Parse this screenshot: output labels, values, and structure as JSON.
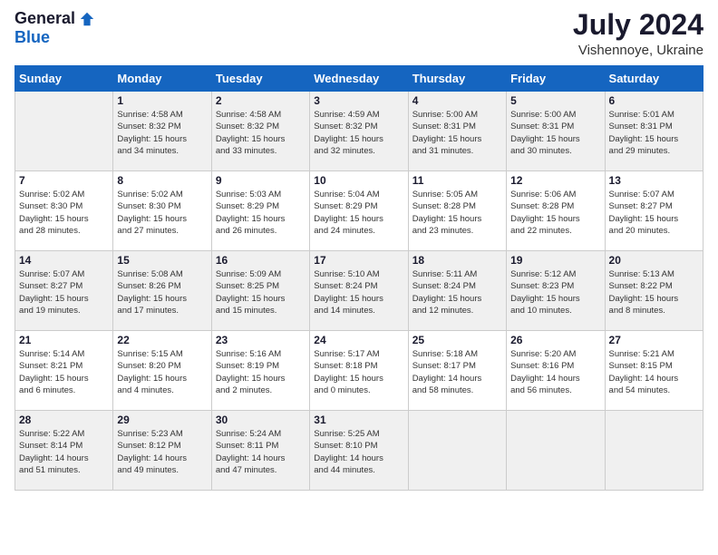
{
  "header": {
    "logo_general": "General",
    "logo_blue": "Blue",
    "month_year": "July 2024",
    "location": "Vishennoye, Ukraine"
  },
  "weekdays": [
    "Sunday",
    "Monday",
    "Tuesday",
    "Wednesday",
    "Thursday",
    "Friday",
    "Saturday"
  ],
  "weeks": [
    [
      {
        "day": "",
        "sunrise": "",
        "sunset": "",
        "daylight": ""
      },
      {
        "day": "1",
        "sunrise": "Sunrise: 4:58 AM",
        "sunset": "Sunset: 8:32 PM",
        "daylight": "Daylight: 15 hours and 34 minutes."
      },
      {
        "day": "2",
        "sunrise": "Sunrise: 4:58 AM",
        "sunset": "Sunset: 8:32 PM",
        "daylight": "Daylight: 15 hours and 33 minutes."
      },
      {
        "day": "3",
        "sunrise": "Sunrise: 4:59 AM",
        "sunset": "Sunset: 8:32 PM",
        "daylight": "Daylight: 15 hours and 32 minutes."
      },
      {
        "day": "4",
        "sunrise": "Sunrise: 5:00 AM",
        "sunset": "Sunset: 8:31 PM",
        "daylight": "Daylight: 15 hours and 31 minutes."
      },
      {
        "day": "5",
        "sunrise": "Sunrise: 5:00 AM",
        "sunset": "Sunset: 8:31 PM",
        "daylight": "Daylight: 15 hours and 30 minutes."
      },
      {
        "day": "6",
        "sunrise": "Sunrise: 5:01 AM",
        "sunset": "Sunset: 8:31 PM",
        "daylight": "Daylight: 15 hours and 29 minutes."
      }
    ],
    [
      {
        "day": "7",
        "sunrise": "Sunrise: 5:02 AM",
        "sunset": "Sunset: 8:30 PM",
        "daylight": "Daylight: 15 hours and 28 minutes."
      },
      {
        "day": "8",
        "sunrise": "Sunrise: 5:02 AM",
        "sunset": "Sunset: 8:30 PM",
        "daylight": "Daylight: 15 hours and 27 minutes."
      },
      {
        "day": "9",
        "sunrise": "Sunrise: 5:03 AM",
        "sunset": "Sunset: 8:29 PM",
        "daylight": "Daylight: 15 hours and 26 minutes."
      },
      {
        "day": "10",
        "sunrise": "Sunrise: 5:04 AM",
        "sunset": "Sunset: 8:29 PM",
        "daylight": "Daylight: 15 hours and 24 minutes."
      },
      {
        "day": "11",
        "sunrise": "Sunrise: 5:05 AM",
        "sunset": "Sunset: 8:28 PM",
        "daylight": "Daylight: 15 hours and 23 minutes."
      },
      {
        "day": "12",
        "sunrise": "Sunrise: 5:06 AM",
        "sunset": "Sunset: 8:28 PM",
        "daylight": "Daylight: 15 hours and 22 minutes."
      },
      {
        "day": "13",
        "sunrise": "Sunrise: 5:07 AM",
        "sunset": "Sunset: 8:27 PM",
        "daylight": "Daylight: 15 hours and 20 minutes."
      }
    ],
    [
      {
        "day": "14",
        "sunrise": "Sunrise: 5:07 AM",
        "sunset": "Sunset: 8:27 PM",
        "daylight": "Daylight: 15 hours and 19 minutes."
      },
      {
        "day": "15",
        "sunrise": "Sunrise: 5:08 AM",
        "sunset": "Sunset: 8:26 PM",
        "daylight": "Daylight: 15 hours and 17 minutes."
      },
      {
        "day": "16",
        "sunrise": "Sunrise: 5:09 AM",
        "sunset": "Sunset: 8:25 PM",
        "daylight": "Daylight: 15 hours and 15 minutes."
      },
      {
        "day": "17",
        "sunrise": "Sunrise: 5:10 AM",
        "sunset": "Sunset: 8:24 PM",
        "daylight": "Daylight: 15 hours and 14 minutes."
      },
      {
        "day": "18",
        "sunrise": "Sunrise: 5:11 AM",
        "sunset": "Sunset: 8:24 PM",
        "daylight": "Daylight: 15 hours and 12 minutes."
      },
      {
        "day": "19",
        "sunrise": "Sunrise: 5:12 AM",
        "sunset": "Sunset: 8:23 PM",
        "daylight": "Daylight: 15 hours and 10 minutes."
      },
      {
        "day": "20",
        "sunrise": "Sunrise: 5:13 AM",
        "sunset": "Sunset: 8:22 PM",
        "daylight": "Daylight: 15 hours and 8 minutes."
      }
    ],
    [
      {
        "day": "21",
        "sunrise": "Sunrise: 5:14 AM",
        "sunset": "Sunset: 8:21 PM",
        "daylight": "Daylight: 15 hours and 6 minutes."
      },
      {
        "day": "22",
        "sunrise": "Sunrise: 5:15 AM",
        "sunset": "Sunset: 8:20 PM",
        "daylight": "Daylight: 15 hours and 4 minutes."
      },
      {
        "day": "23",
        "sunrise": "Sunrise: 5:16 AM",
        "sunset": "Sunset: 8:19 PM",
        "daylight": "Daylight: 15 hours and 2 minutes."
      },
      {
        "day": "24",
        "sunrise": "Sunrise: 5:17 AM",
        "sunset": "Sunset: 8:18 PM",
        "daylight": "Daylight: 15 hours and 0 minutes."
      },
      {
        "day": "25",
        "sunrise": "Sunrise: 5:18 AM",
        "sunset": "Sunset: 8:17 PM",
        "daylight": "Daylight: 14 hours and 58 minutes."
      },
      {
        "day": "26",
        "sunrise": "Sunrise: 5:20 AM",
        "sunset": "Sunset: 8:16 PM",
        "daylight": "Daylight: 14 hours and 56 minutes."
      },
      {
        "day": "27",
        "sunrise": "Sunrise: 5:21 AM",
        "sunset": "Sunset: 8:15 PM",
        "daylight": "Daylight: 14 hours and 54 minutes."
      }
    ],
    [
      {
        "day": "28",
        "sunrise": "Sunrise: 5:22 AM",
        "sunset": "Sunset: 8:14 PM",
        "daylight": "Daylight: 14 hours and 51 minutes."
      },
      {
        "day": "29",
        "sunrise": "Sunrise: 5:23 AM",
        "sunset": "Sunset: 8:12 PM",
        "daylight": "Daylight: 14 hours and 49 minutes."
      },
      {
        "day": "30",
        "sunrise": "Sunrise: 5:24 AM",
        "sunset": "Sunset: 8:11 PM",
        "daylight": "Daylight: 14 hours and 47 minutes."
      },
      {
        "day": "31",
        "sunrise": "Sunrise: 5:25 AM",
        "sunset": "Sunset: 8:10 PM",
        "daylight": "Daylight: 14 hours and 44 minutes."
      },
      {
        "day": "",
        "sunrise": "",
        "sunset": "",
        "daylight": ""
      },
      {
        "day": "",
        "sunrise": "",
        "sunset": "",
        "daylight": ""
      },
      {
        "day": "",
        "sunrise": "",
        "sunset": "",
        "daylight": ""
      }
    ]
  ]
}
